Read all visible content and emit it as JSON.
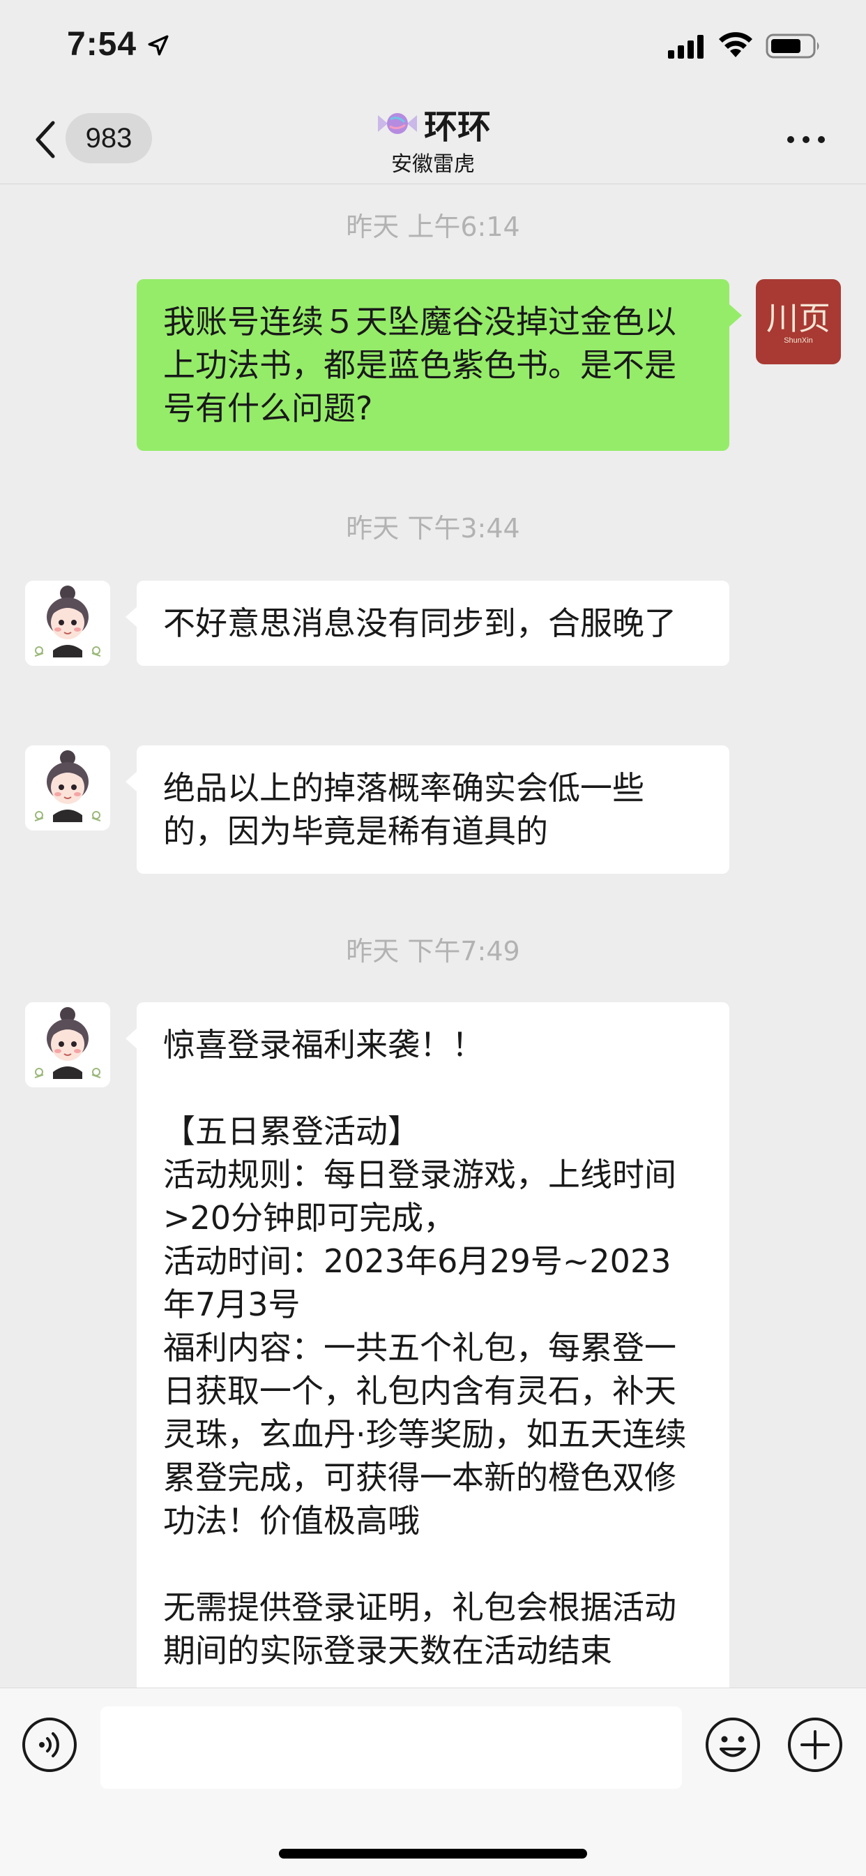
{
  "status_bar": {
    "time": "7:54",
    "icons": [
      "location-arrow-icon",
      "cellular-signal-icon",
      "wifi-icon",
      "battery-icon"
    ]
  },
  "nav": {
    "unread_count": "983",
    "title": "环环",
    "subtitle": "安徽雷虎",
    "icons": [
      "back-chevron-icon",
      "candy-icon",
      "more-dots-icon"
    ]
  },
  "messages": [
    {
      "type": "timestamp",
      "text": "昨天 上午6:14"
    },
    {
      "type": "message",
      "side": "right",
      "text": "我账号连续５天坠魔谷没掉过金色以上功法书，都是蓝色紫色书。是不是号有什么问题?"
    },
    {
      "type": "timestamp",
      "text": "昨天 下午3:44"
    },
    {
      "type": "message",
      "side": "left",
      "text": "不好意思消息没有同步到，合服晚了"
    },
    {
      "type": "message",
      "side": "left",
      "text": "绝品以上的掉落概率确实会低一些的，因为毕竟是稀有道具的"
    },
    {
      "type": "timestamp",
      "text": "昨天 下午7:49"
    },
    {
      "type": "message",
      "side": "left",
      "text": "惊喜登录福利来袭！！\n\n【五日累登活动】\n活动规则：每日登录游戏，上线时间>20分钟即可完成，\n活动时间：2023年6月29号~2023年7月3号\n福利内容：一共五个礼包，每累登一日获取一个，礼包内含有灵石，补天灵珠，玄血丹·珍等奖励，如五天连续累登完成，可获得一本新的橙色双修功法！价值极高哦\n\n无需提供登录证明，礼包会根据活动期间的实际登录天数在活动结束"
    }
  ],
  "avatars": {
    "self_text": "川页",
    "self_subtext": "ShunXin",
    "contact": "cartoon-girl-avatar"
  },
  "input_bar": {
    "placeholder": "",
    "icons": [
      "voice-icon",
      "emoji-icon",
      "plus-icon"
    ]
  },
  "colors": {
    "background": "#ededed",
    "sent_bubble": "#95ec69",
    "received_bubble": "#ffffff",
    "timestamp_text": "#b2b2b2",
    "self_avatar": "#a83a33"
  }
}
